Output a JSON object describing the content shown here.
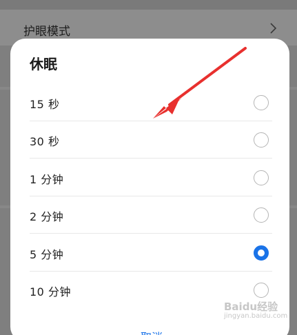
{
  "background": {
    "row_label": "护眼模式",
    "row_chevron_icon": "chevron-right-icon"
  },
  "dialog": {
    "title": "休眠",
    "options": [
      {
        "label": "15 秒",
        "selected": false
      },
      {
        "label": "30 秒",
        "selected": false
      },
      {
        "label": "1 分钟",
        "selected": false
      },
      {
        "label": "2 分钟",
        "selected": false
      },
      {
        "label": "5 分钟",
        "selected": true
      },
      {
        "label": "10 分钟",
        "selected": false
      }
    ],
    "cancel_label": "取消"
  },
  "annotation": {
    "arrow_color": "#e8302e"
  },
  "watermark": {
    "text": "Baidu经验",
    "sub": "jingyan.baidu.com"
  },
  "colors": {
    "accent": "#1a73e8",
    "arrow": "#e8302e"
  }
}
